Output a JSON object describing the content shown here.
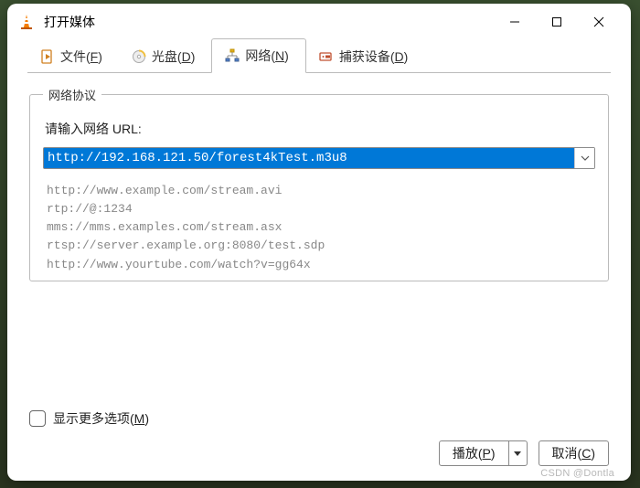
{
  "window": {
    "title": "打开媒体"
  },
  "titlebar_buttons": {
    "minimize": "minimize",
    "maximize": "maximize",
    "close": "close"
  },
  "tabs": {
    "file": {
      "label": "文件",
      "hotkey": "F"
    },
    "disc": {
      "label": "光盘",
      "hotkey": "D"
    },
    "network": {
      "label": "网络",
      "hotkey": "N"
    },
    "capture": {
      "label": "捕获设备",
      "hotkey": "D"
    }
  },
  "network_panel": {
    "group_title": "网络协议",
    "url_label": "请输入网络 URL:",
    "url_value": "http://192.168.121.50/forest4kTest.m3u8",
    "examples": [
      "http://www.example.com/stream.avi",
      "rtp://@:1234",
      "mms://mms.examples.com/stream.asx",
      "rtsp://server.example.org:8080/test.sdp",
      "http://www.yourtube.com/watch?v=gg64x"
    ]
  },
  "more_options": {
    "label": "显示更多选项",
    "hotkey": "M",
    "checked": false
  },
  "buttons": {
    "play": {
      "label": "播放",
      "hotkey": "P"
    },
    "cancel": {
      "label": "取消",
      "hotkey": "C"
    }
  },
  "watermark": "CSDN @Dontla"
}
